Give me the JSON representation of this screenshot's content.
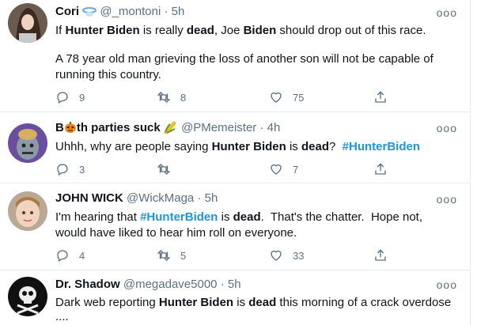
{
  "tweets": [
    {
      "name": "Cori",
      "handle": "@_montoni",
      "dot": "·",
      "time": "5h",
      "text_parts": {
        "p1": "If ",
        "b1": "Hunter Biden",
        "p2": " is really ",
        "b2": "dead",
        "p3": ", Joe ",
        "b3": "Biden",
        "p4": " should drop out of this race.",
        "para2": "A 78 year old man grieving the loss of another son will not be capable of running this country."
      },
      "replies": "9",
      "retweets": "8",
      "likes": "75",
      "more": "ooo"
    },
    {
      "name_prefix": "B",
      "name_suffix": "th parties suck",
      "handle": "@PMemeister",
      "dot": "·",
      "time": "4h",
      "text_parts": {
        "p1": "Uhhh, why are people saying ",
        "b1": "Hunter Biden",
        "p2": " is ",
        "b2": "dead",
        "p3": "?  ",
        "hashtag": "#HunterBiden"
      },
      "replies": "3",
      "retweets": "",
      "likes": "7",
      "more": "ooo"
    },
    {
      "name": "JOHN WICK",
      "handle": "@WickMaga",
      "dot": "·",
      "time": "5h",
      "text_parts": {
        "p1": "I'm hearing that ",
        "hashtag": "#HunterBiden",
        "p2": " is ",
        "b1": "dead",
        "p3": ".  That's the chatter.  Hope not,",
        "line2": "would have liked to hear him roll on everyone."
      },
      "replies": "4",
      "retweets": "5",
      "likes": "33",
      "more": "ooo"
    },
    {
      "name": "Dr. Shadow",
      "handle": "@megadave5000",
      "dot": "·",
      "time": "5h",
      "text_parts": {
        "p1": "Dark web reporting ",
        "b1": "Hunter Biden",
        "p2": " is ",
        "b2": "dead",
        "p3": " this morning of a crack overdose",
        "line2": "...."
      },
      "more": "ooo"
    }
  ],
  "colors": {
    "text": "#0f1419",
    "secondary": "#5b7083",
    "link": "#1b95e0",
    "border": "#e6ecf0"
  }
}
